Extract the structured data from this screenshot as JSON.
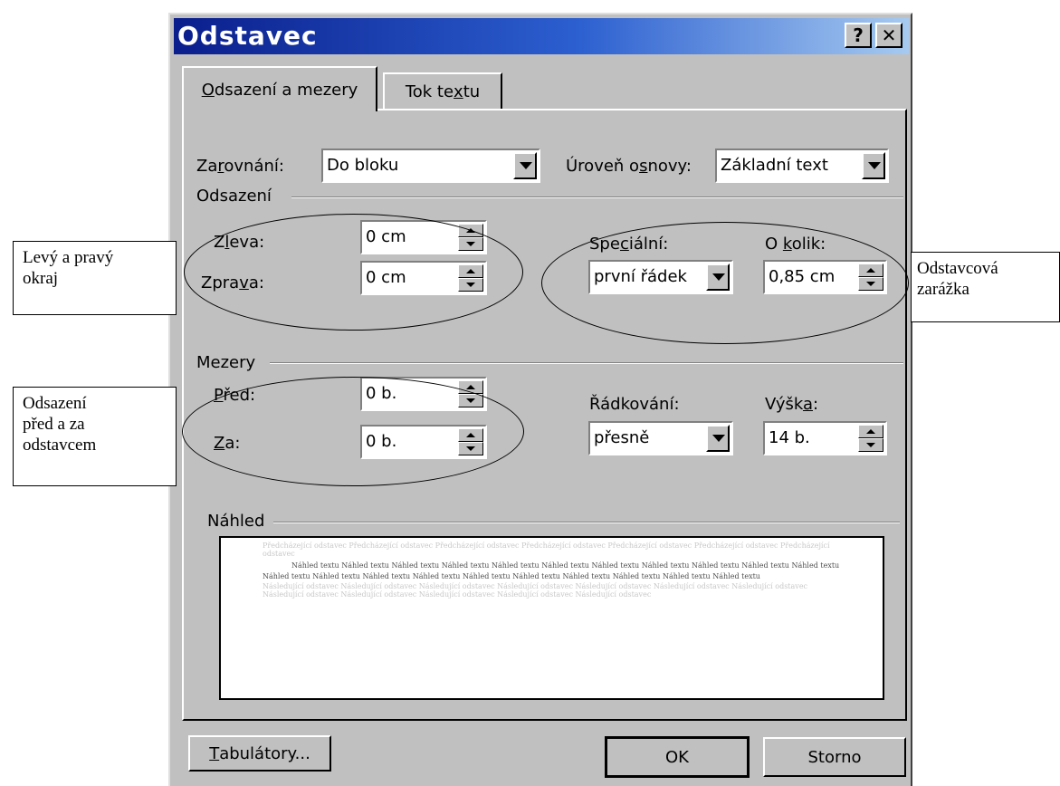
{
  "dialog": {
    "title": "Odstavec",
    "help_button": "?",
    "close_button": "✕"
  },
  "tabs": [
    {
      "pre": "",
      "key": "O",
      "post": "dsazení a mezery"
    },
    {
      "pre": "Tok te",
      "key": "x",
      "post": "tu"
    }
  ],
  "general": {
    "alignment_label": {
      "pre": "Za",
      "key": "r",
      "post": "ovnání:"
    },
    "alignment_value": "Do bloku",
    "outline_label": {
      "pre": "Úroveň o",
      "key": "s",
      "post": "novy:"
    },
    "outline_value": "Základní text"
  },
  "indent": {
    "group": "Odsazení",
    "left_label": {
      "pre": "Z",
      "key": "l",
      "post": "eva:"
    },
    "left_value": "0 cm",
    "right_label": {
      "pre": "Zpra",
      "key": "v",
      "post": "a:"
    },
    "right_value": "0 cm",
    "special_label": {
      "pre": "Spe",
      "key": "c",
      "post": "iální:"
    },
    "special_value": "první řádek",
    "by_label": {
      "pre": "O ",
      "key": "k",
      "post": "olik:"
    },
    "by_value": "0,85 cm"
  },
  "spacing": {
    "group": "Mezery",
    "before_label": {
      "pre": "",
      "key": "P",
      "post": "řed:"
    },
    "before_value": "0 b.",
    "after_label": {
      "pre": "",
      "key": "Z",
      "post": "a:"
    },
    "after_value": "0 b.",
    "line_label": {
      "pre": "Řádkování",
      "key": "",
      "post": ":"
    },
    "line_value": "přesně",
    "at_label": {
      "pre": "Výšk",
      "key": "a",
      "post": ":"
    },
    "at_value": "14 b."
  },
  "preview": {
    "group": "Náhled",
    "previous": "Předcházející odstavec Předcházející odstavec Předcházející odstavec Předcházející odstavec Předcházející odstavec Předcházející odstavec Předcházející odstavec",
    "current": "Náhled textu Náhled textu Náhled textu Náhled textu Náhled textu Náhled textu Náhled textu Náhled textu Náhled textu Náhled textu Náhled textu Náhled textu Náhled textu Náhled textu Náhled textu Náhled textu Náhled textu Náhled textu Náhled textu Náhled textu Náhled textu",
    "following": "Následující odstavec Následující odstavec Následující odstavec Následující odstavec Následující odstavec Následující odstavec Následující odstavec Následující odstavec Následující odstavec Následující odstavec Následující odstavec Následující odstavec"
  },
  "buttons": {
    "tabs_button": {
      "pre": "",
      "key": "T",
      "post": "abulátory..."
    },
    "ok": "OK",
    "cancel": "Storno"
  },
  "annotations": {
    "margins": "Levý a pravý\nokraj",
    "first_line": "Odstavcová\nzarážka",
    "paragraph_spacing": "Odsazení\npřed a za\nodstavcem"
  }
}
